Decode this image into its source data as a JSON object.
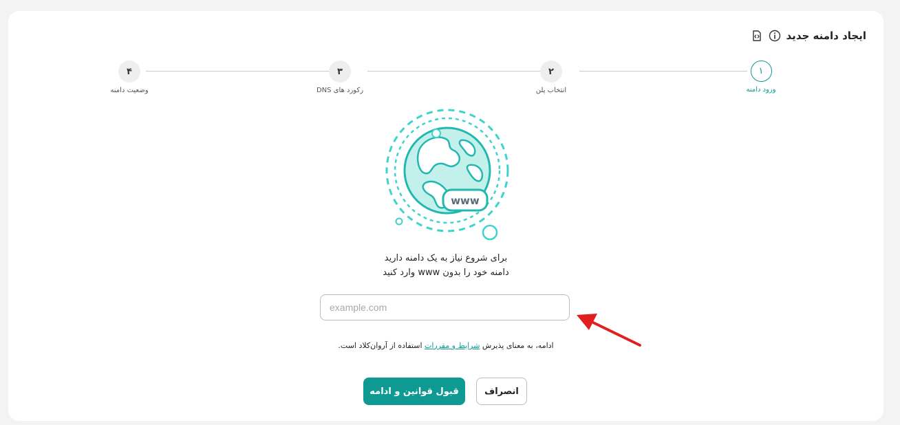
{
  "header": {
    "title": "ایجاد دامنه جدید",
    "info_icon": "info-icon",
    "code_icon": "code-icon"
  },
  "stepper": {
    "steps": [
      {
        "number": "۱",
        "label": "ورود دامنه",
        "active": true
      },
      {
        "number": "۲",
        "label": "انتخاب پلن",
        "active": false
      },
      {
        "number": "۳",
        "label": "رکورد های DNS",
        "active": false
      },
      {
        "number": "۴",
        "label": "وضعیت دامنه",
        "active": false
      }
    ]
  },
  "illustration": {
    "badge_text": "www",
    "accent_color": "#26c6bf"
  },
  "intro": {
    "line1": "برای شروع نیاز به یک دامنه دارید",
    "line2": "دامنه خود را بدون www وارد کنید"
  },
  "domain_input": {
    "placeholder": "example.com",
    "value": ""
  },
  "terms": {
    "prefix": "ادامه، به معنای پذیرش",
    "link": "شرایط و مقررات",
    "suffix": "استفاده از آروان‌کلاد است."
  },
  "actions": {
    "accept_label": "قبول قوانین و ادامه",
    "cancel_label": "انصراف"
  },
  "colors": {
    "primary": "#0e9a93",
    "annotation_arrow": "#e02020"
  }
}
